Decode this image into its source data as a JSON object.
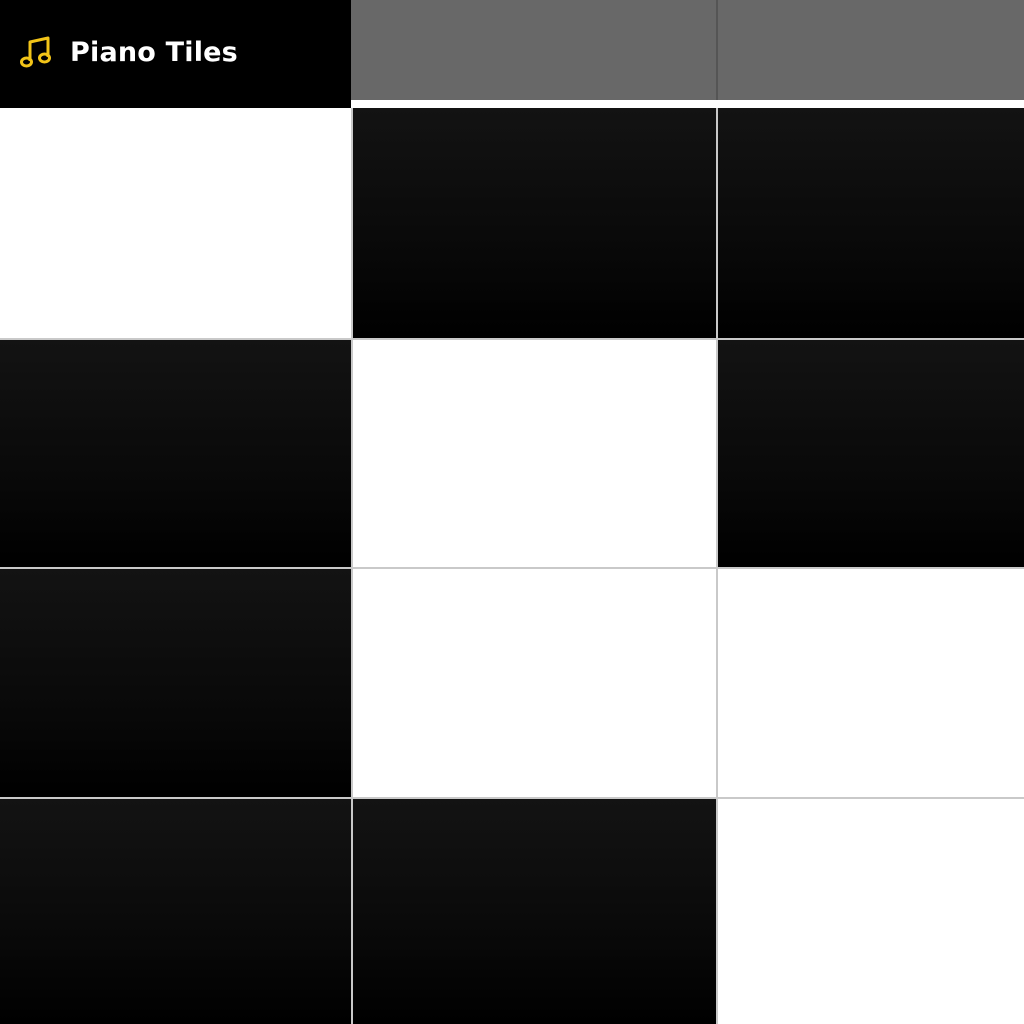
{
  "title_bar": {
    "icon": "music-note-icon",
    "icon_color": "#f2c418",
    "title": "Piano Tiles",
    "background": "#000000"
  },
  "colors": {
    "black_tile": "#000000",
    "white_tile": "#ffffff",
    "upcoming_row": "#686868",
    "grid_line": "#c9c9c9"
  },
  "board": {
    "columns": 3,
    "rows": [
      [
        "white",
        "black",
        "black"
      ],
      [
        "black",
        "white",
        "black"
      ],
      [
        "black",
        "white",
        "white"
      ],
      [
        "black",
        "black",
        "white"
      ]
    ]
  }
}
